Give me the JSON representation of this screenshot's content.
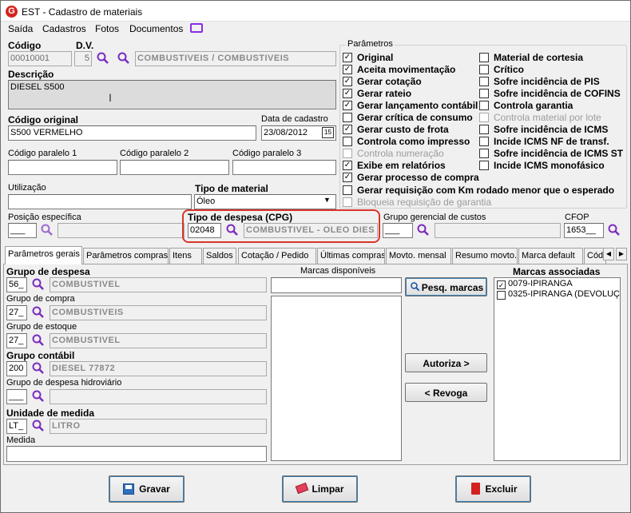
{
  "window": {
    "title": "EST - Cadastro de materiais"
  },
  "menu": [
    "Saída",
    "Cadastros",
    "Fotos",
    "Documentos"
  ],
  "codigo": {
    "label": "Código",
    "value": "00010001"
  },
  "dv": {
    "label": "D.V.",
    "value": "5"
  },
  "categoria": {
    "value": "COMBUSTIVEIS / COMBUSTIVEIS"
  },
  "descricao": {
    "label": "Descrição",
    "value": "DIESEL S500"
  },
  "codigo_original": {
    "label": "Código original",
    "value": "S500 VERMELHO"
  },
  "data_cadastro": {
    "label": "Data de cadastro",
    "value": "23/08/2012",
    "cal": "15"
  },
  "codigo_paralelo_1": {
    "label": "Código paralelo 1",
    "value": ""
  },
  "codigo_paralelo_2": {
    "label": "Código paralelo 2",
    "value": ""
  },
  "codigo_paralelo_3": {
    "label": "Código paralelo 3",
    "value": ""
  },
  "utilizacao": {
    "label": "Utilização",
    "value": ""
  },
  "tipo_material": {
    "label": "Tipo de material",
    "value": "Óleo"
  },
  "posicao_especifica": {
    "label": "Posição específica",
    "value": "___"
  },
  "tipo_despesa": {
    "label": "Tipo de despesa (CPG)",
    "code": "02048",
    "desc": "COMBUSTIVEL - OLEO DIES"
  },
  "grupo_gerencial": {
    "label": "Grupo gerencial de custos",
    "value": "___"
  },
  "cfop": {
    "label": "CFOP",
    "value": "1653__"
  },
  "parametros": {
    "title": "Parâmetros",
    "left": [
      {
        "label": "Original",
        "checked": true,
        "enabled": true
      },
      {
        "label": "Aceita movimentação",
        "checked": true,
        "enabled": true
      },
      {
        "label": "Gerar cotação",
        "checked": true,
        "enabled": true
      },
      {
        "label": "Gerar rateio",
        "checked": true,
        "enabled": true
      },
      {
        "label": "Gerar lançamento contábil",
        "checked": true,
        "enabled": true
      },
      {
        "label": "Gerar crítica de consumo",
        "checked": false,
        "enabled": true
      },
      {
        "label": "Gerar custo de frota",
        "checked": true,
        "enabled": true
      },
      {
        "label": "Controla como impresso",
        "checked": false,
        "enabled": true
      },
      {
        "label": "Controla numeração",
        "checked": false,
        "enabled": false
      },
      {
        "label": "Exibe em relatórios",
        "checked": true,
        "enabled": true
      },
      {
        "label": "Gerar processo de compra",
        "checked": true,
        "enabled": true
      },
      {
        "label": "Gerar requisição com Km rodado menor que o esperado",
        "checked": false,
        "enabled": true
      },
      {
        "label": "Bloqueia requisição de garantia",
        "checked": false,
        "enabled": false
      }
    ],
    "right": [
      {
        "label": "Material de cortesia",
        "checked": false,
        "enabled": true
      },
      {
        "label": "Crítico",
        "checked": false,
        "enabled": true
      },
      {
        "label": "Sofre incidência de PIS",
        "checked": false,
        "enabled": true
      },
      {
        "label": "Sofre incidência de COFINS",
        "checked": false,
        "enabled": true
      },
      {
        "label": "Controla garantia",
        "checked": false,
        "enabled": true
      },
      {
        "label": "Controla material por lote",
        "checked": false,
        "enabled": false
      },
      {
        "label": "Sofre incidência de ICMS",
        "checked": false,
        "enabled": true
      },
      {
        "label": "Incide ICMS NF de transf.",
        "checked": false,
        "enabled": true
      },
      {
        "label": "Sofre incidência de ICMS ST",
        "checked": false,
        "enabled": true
      },
      {
        "label": "Incide ICMS monofásico",
        "checked": false,
        "enabled": true
      }
    ]
  },
  "tabs": [
    "Parâmetros gerais",
    "Parâmetros compras",
    "Itens",
    "Saldos",
    "Cotação / Pedido",
    "Últimas compras",
    "Movto. mensal",
    "Resumo movto.",
    "Marca default",
    "Códi"
  ],
  "general": {
    "grupo_despesa": {
      "label": "Grupo de despesa",
      "code": "56_",
      "desc": "COMBUSTIVEL"
    },
    "grupo_compra": {
      "label": "Grupo de compra",
      "code": "27_",
      "desc": "COMBUSTIVEIS"
    },
    "grupo_estoque": {
      "label": "Grupo de estoque",
      "code": "27_",
      "desc": "COMBUSTIVEL"
    },
    "grupo_contabil": {
      "label": "Grupo contábil",
      "code": "200",
      "desc": "DIESEL 77872"
    },
    "grupo_hidroviario": {
      "label": "Grupo de despesa hidroviário",
      "code": "___",
      "desc": ""
    },
    "unidade_medida": {
      "label": "Unidade de medida",
      "code": "LT_",
      "desc": "LITRO"
    },
    "medida": {
      "label": "Medida",
      "value": ""
    }
  },
  "marcas": {
    "disponiveis_label": "Marcas disponíveis",
    "pesq_label": "Pesq. marcas",
    "autoriza_label": "Autoriza >",
    "revoga_label": "< Revoga",
    "associadas_label": "Marcas associadas",
    "associadas": [
      {
        "label": "0079-IPIRANGA",
        "checked": true
      },
      {
        "label": "0325-IPIRANGA (DEVOLUÇ",
        "checked": false
      }
    ]
  },
  "buttons": {
    "gravar": "Gravar",
    "limpar": "Limpar",
    "excluir": "Excluir"
  },
  "colors": {
    "magnifier": "#7b2cbf",
    "highlight": "#d9352a"
  }
}
